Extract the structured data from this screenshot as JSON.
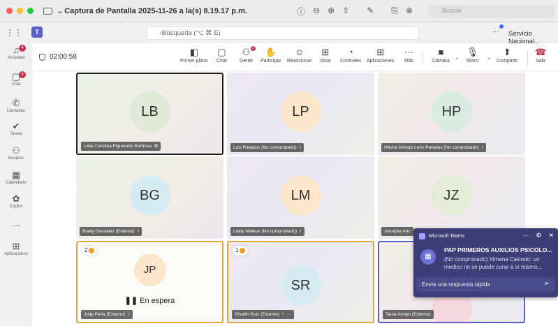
{
  "window": {
    "title": "Captura de Pantalla 2025-11-26 a la(s) 8.19.17 p.m.",
    "search_placeholder": "Buscar",
    "lights": [
      "#ff5f57",
      "#febc2e",
      "#28c840"
    ]
  },
  "teams": {
    "search_placeholder": "Búsqueda (⌥ ⌘ E)",
    "org": "Servicio Nacional...",
    "accent": "#5b5fc7"
  },
  "rail": [
    {
      "label": "Actividad",
      "icon": "bell-icon",
      "badge": "4"
    },
    {
      "label": "Chat",
      "icon": "chat-icon",
      "badge": "5"
    },
    {
      "label": "Llamadas",
      "icon": "phone-icon",
      "badge": ""
    },
    {
      "label": "Tareas",
      "icon": "tasks-icon",
      "badge": ""
    },
    {
      "label": "Equipos",
      "icon": "teams-icon",
      "badge": ""
    },
    {
      "label": "Calendario",
      "icon": "calendar-icon",
      "badge": ""
    },
    {
      "label": "Copilot",
      "icon": "copilot-icon",
      "badge": ""
    },
    {
      "label": "",
      "icon": "more-icon",
      "badge": ""
    },
    {
      "label": "Aplicaciones",
      "icon": "apps-icon",
      "badge": ""
    }
  ],
  "meeting": {
    "timer": "02:00:58",
    "tools": [
      {
        "label": "Primer plano",
        "icon": "spotlight-icon"
      },
      {
        "label": "Chat",
        "icon": "chat-icon"
      },
      {
        "label": "Gente",
        "icon": "people-icon",
        "badge": "2"
      },
      {
        "label": "Participar",
        "icon": "raise-hand-icon"
      },
      {
        "label": "Reaccionar",
        "icon": "smile-icon"
      },
      {
        "label": "Vista",
        "icon": "view-icon"
      },
      {
        "label": "Controles",
        "icon": "controls-icon"
      },
      {
        "label": "Aplicaciones",
        "icon": "apps-icon"
      },
      {
        "label": "Más",
        "icon": "more-icon"
      },
      {
        "label": "Cámara",
        "icon": "camera-off-icon"
      },
      {
        "label": "Micro",
        "icon": "mic-icon"
      },
      {
        "label": "Compartir",
        "icon": "share-icon"
      },
      {
        "label": "Salir",
        "icon": "leave-icon"
      }
    ]
  },
  "participants": [
    {
      "initials": "LB",
      "name": "Leila Carolina Figueredo Barbosa",
      "avatar_color": "#dfe9d6"
    },
    {
      "initials": "LP",
      "name": "Luis Palacios (No comprobado)",
      "avatar_color": "#fbe6cc"
    },
    {
      "initials": "HP",
      "name": "Héctor Alfredo León Paredes (No comprobado)",
      "avatar_color": "#d9ebe1"
    },
    {
      "initials": "BG",
      "name": "Bratly González (Externo)",
      "avatar_color": "#d6ecf2"
    },
    {
      "initials": "LM",
      "name": "Leidy Mateus (No comprobado)",
      "avatar_color": "#fbe6cc"
    },
    {
      "initials": "JZ",
      "name": "Jennyfer Aric",
      "avatar_color": "#e2ecd6"
    },
    {
      "initials": "JP",
      "name": "Judy Peña (Externo)",
      "avatar_color": "#fbe6cc",
      "hand": "2",
      "status": "En espera"
    },
    {
      "initials": "SR",
      "name": "Sharith Ruiz (Externo)",
      "avatar_color": "#d6ecf2",
      "hand": "1"
    },
    {
      "initials": "",
      "name": "Tania Arroyo (Externo)",
      "avatar_color": "#f6d7dc"
    }
  ],
  "toast": {
    "app": "Microsoft Teams",
    "title": "PAP PRIMEROS AUXILIOS PSICOLO...",
    "body": "(No comprobado) Ximena Caicedo: un medico no se puede curar a sí mismo...",
    "reply_placeholder": "Envíe una respuesta rápida",
    "bg": "#3d3e78"
  }
}
